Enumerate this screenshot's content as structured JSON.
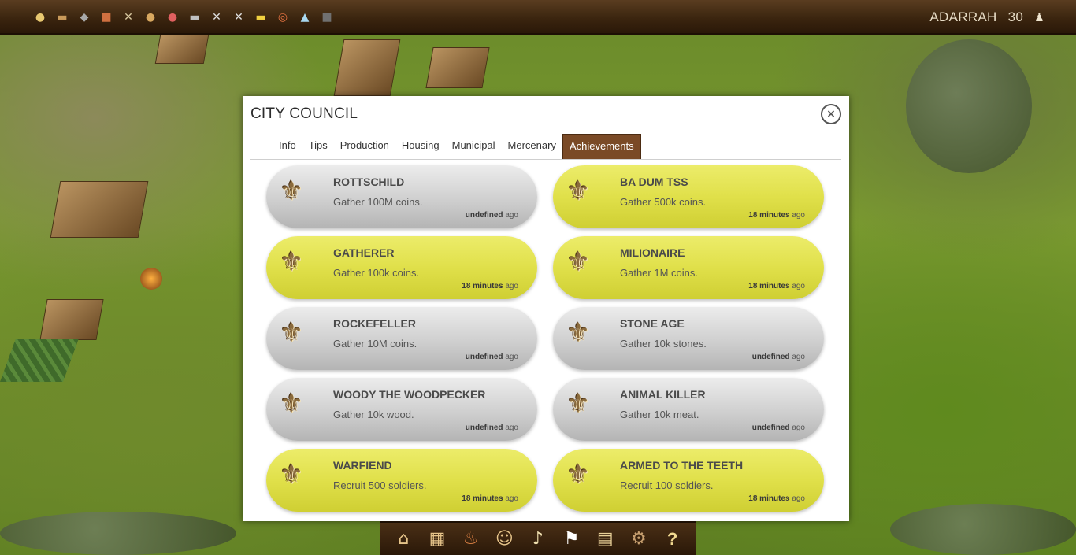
{
  "topbar": {
    "resources": [
      "gold-coins-icon",
      "wood-log-icon",
      "stone-icon",
      "clay-icon",
      "tools-icon",
      "bread-icon",
      "meat-icon",
      "iron-bar-icon",
      "swords-icon",
      "hammer-icon",
      "gold-bar-icon",
      "rope-icon",
      "water-icon",
      "coal-icon"
    ],
    "player_name": "ADARRAH",
    "player_level": "30"
  },
  "dialog": {
    "title": "CITY COUNCIL",
    "tabs": [
      {
        "label": "Info"
      },
      {
        "label": "Tips"
      },
      {
        "label": "Production"
      },
      {
        "label": "Housing"
      },
      {
        "label": "Municipal"
      },
      {
        "label": "Mercenary"
      },
      {
        "label": "Achievements",
        "active": true
      }
    ],
    "achievements": [
      {
        "title": "ROTTSCHILD",
        "desc": "Gather 100M coins.",
        "time": "undefined",
        "ago": "ago",
        "status": "locked"
      },
      {
        "title": "BA DUM TSS",
        "desc": "Gather 500k coins.",
        "time": "18 minutes",
        "ago": "ago",
        "status": "unlocked"
      },
      {
        "title": "GATHERER",
        "desc": "Gather 100k coins.",
        "time": "18 minutes",
        "ago": "ago",
        "status": "unlocked"
      },
      {
        "title": "MILIONAIRE",
        "desc": "Gather 1M coins.",
        "time": "18 minutes",
        "ago": "ago",
        "status": "unlocked"
      },
      {
        "title": "ROCKEFELLER",
        "desc": "Gather 10M coins.",
        "time": "undefined",
        "ago": "ago",
        "status": "locked"
      },
      {
        "title": "STONE AGE",
        "desc": "Gather 10k stones.",
        "time": "undefined",
        "ago": "ago",
        "status": "locked"
      },
      {
        "title": "WOODY THE WOODPECKER",
        "desc": "Gather 10k wood.",
        "time": "undefined",
        "ago": "ago",
        "status": "locked"
      },
      {
        "title": "ANIMAL KILLER",
        "desc": "Gather 10k meat.",
        "time": "undefined",
        "ago": "ago",
        "status": "locked"
      },
      {
        "title": "WARFIEND",
        "desc": "Recruit 500 soldiers.",
        "time": "18 minutes",
        "ago": "ago",
        "status": "unlocked"
      },
      {
        "title": "ARMED TO THE TEETH",
        "desc": "Recruit 100 soldiers.",
        "time": "18 minutes",
        "ago": "ago",
        "status": "unlocked"
      }
    ]
  },
  "bottombar": {
    "tools": [
      "house-icon",
      "crates-icon",
      "forge-icon",
      "citizens-icon",
      "horn-icon",
      "flag-icon",
      "scrolls-icon",
      "catapult-icon",
      "help-icon"
    ],
    "help_glyph": "?"
  },
  "colors": {
    "unlocked": "#e0e04a",
    "locked": "#cfcfcf",
    "active_tab": "#7a4a26"
  }
}
